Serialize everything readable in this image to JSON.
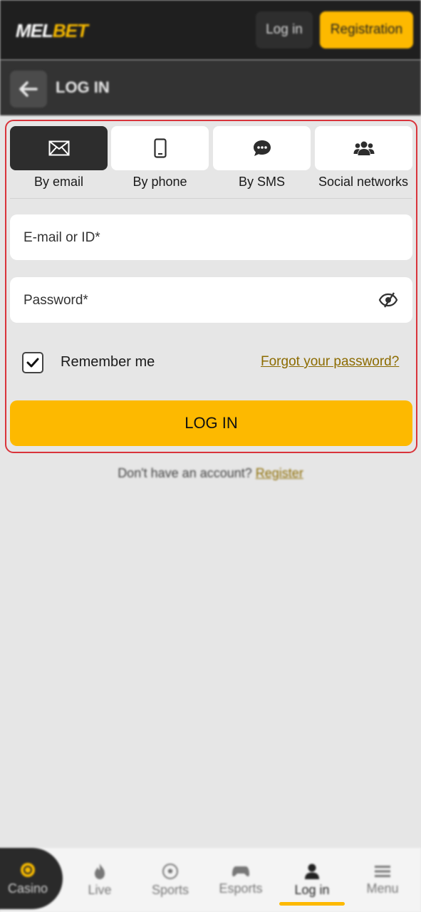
{
  "header": {
    "logo_part1": "MEL",
    "logo_part2": "BET",
    "login_button": "Log in",
    "registration_button": "Registration"
  },
  "subheader": {
    "title": "LOG IN"
  },
  "tabs": [
    {
      "label": "By email",
      "icon": "envelope-icon",
      "active": true
    },
    {
      "label": "By phone",
      "icon": "phone-icon",
      "active": false
    },
    {
      "label": "By SMS",
      "icon": "chat-bubble-icon",
      "active": false
    },
    {
      "label": "Social networks",
      "icon": "users-icon",
      "active": false
    }
  ],
  "form": {
    "email_placeholder": "E-mail or ID*",
    "password_placeholder": "Password*",
    "remember_label": "Remember me",
    "remember_checked": true,
    "forgot_link": "Forgot your password?",
    "submit_label": "LOG IN"
  },
  "footer_prompt": {
    "text": "Don't have an account?",
    "link": "Register"
  },
  "bottom_nav": [
    {
      "label": "Casino",
      "icon": "casino-chip-icon"
    },
    {
      "label": "Live",
      "icon": "flame-icon"
    },
    {
      "label": "Sports",
      "icon": "soccer-ball-icon"
    },
    {
      "label": "Esports",
      "icon": "gamepad-icon"
    },
    {
      "label": "Log in",
      "icon": "user-icon",
      "active": true
    },
    {
      "label": "Menu",
      "icon": "hamburger-icon"
    }
  ],
  "colors": {
    "accent": "#fdb900",
    "header_bg": "#1f1f1f",
    "highlight_border": "#d9343b"
  }
}
